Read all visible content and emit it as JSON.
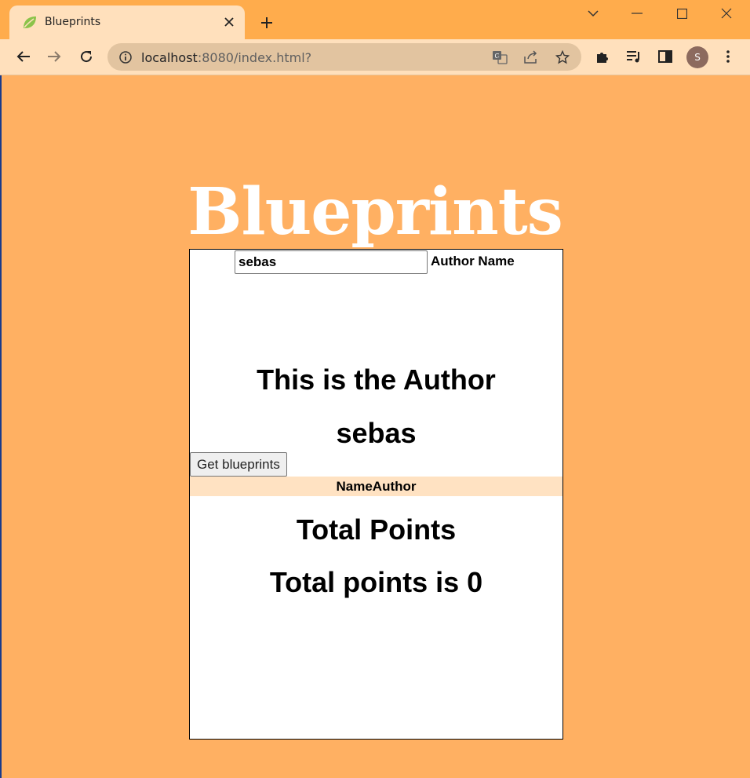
{
  "browser": {
    "tab_title": "Blueprints",
    "url_host": "localhost",
    "url_rest": ":8080/index.html?",
    "avatar_letter": "S",
    "colors": {
      "titlebar": "#ffac4c",
      "toolbar": "#ffe0bc",
      "omnibox": "#e2c4a0"
    }
  },
  "page": {
    "title": "Blueprints",
    "author_input": {
      "value": "sebas",
      "placeholder": ""
    },
    "author_label": "Author Name",
    "author_heading": "This is the Author",
    "author_name": "sebas",
    "get_button_label": "Get blueprints",
    "table_header": "NameAuthor",
    "total_heading": "Total Points",
    "total_value_text": "Total points is 0",
    "colors": {
      "background": "#ffb062",
      "table_header_bg": "#ffe2c2"
    }
  },
  "icons": {
    "favicon": "spring-leaf-icon",
    "tab_close": "close-icon",
    "new_tab": "plus-icon",
    "back": "back-arrow-icon",
    "forward": "forward-arrow-icon",
    "reload": "reload-icon",
    "site_info": "info-icon",
    "translate": "translate-icon",
    "share": "share-icon",
    "bookmark": "star-icon",
    "extensions": "puzzle-icon",
    "reading_list": "reading-list-icon",
    "side_panel": "side-panel-icon",
    "menu": "kebab-menu-icon"
  }
}
